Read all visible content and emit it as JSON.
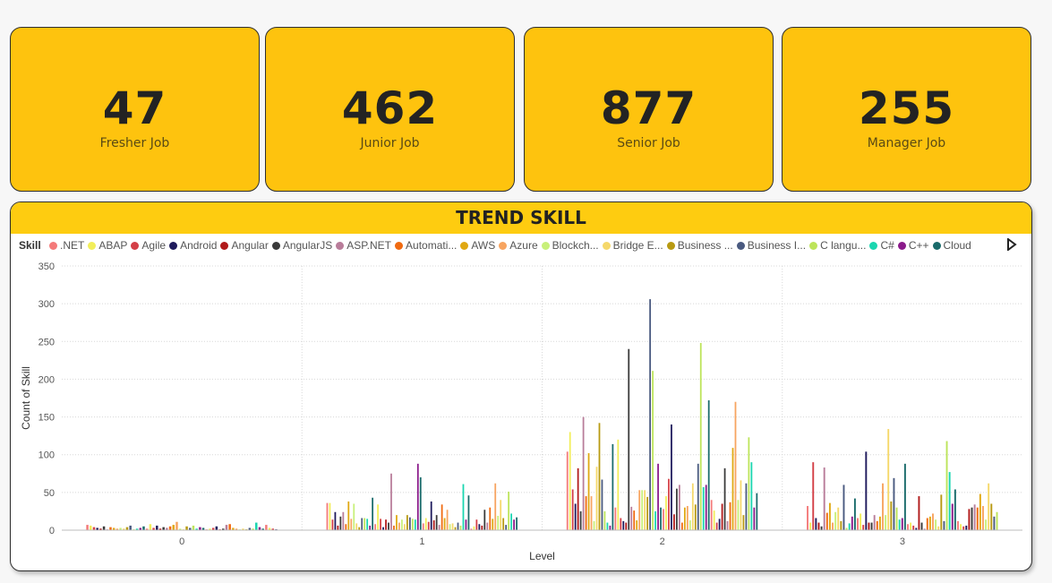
{
  "kpis": [
    {
      "value": "47",
      "label": "Fresher Job"
    },
    {
      "value": "462",
      "label": "Junior Job"
    },
    {
      "value": "877",
      "label": "Senior Job"
    },
    {
      "value": "255",
      "label": "Manager Job"
    }
  ],
  "colors": {
    "card": "#fec30e",
    "header": "#fecc10"
  },
  "legend_nav_icon": "triangle-right-icon",
  "chart_data": {
    "type": "bar",
    "title": "TREND SKILL",
    "xlabel": "Level",
    "ylabel": "Count of Skill",
    "legend_title": "Skill",
    "legend_placement": "top-left",
    "grid": true,
    "ylim": [
      0,
      350
    ],
    "yticks": [
      "0",
      "50",
      "100",
      "150",
      "200",
      "250",
      "300",
      "350"
    ],
    "categories": [
      "0",
      "1",
      "2",
      "3"
    ],
    "legend": [
      {
        "name": ".NET",
        "color": "#f47a7a"
      },
      {
        "name": "ABAP",
        "color": "#f2ee5a"
      },
      {
        "name": "Agile",
        "color": "#d43f47"
      },
      {
        "name": "Android",
        "color": "#1e1a5c"
      },
      {
        "name": "Angular",
        "color": "#b11a1a"
      },
      {
        "name": "AngularJS",
        "color": "#3a3a3a"
      },
      {
        "name": "ASP.NET",
        "color": "#b97d9a"
      },
      {
        "name": "Automati...",
        "color": "#f06a10"
      },
      {
        "name": "AWS",
        "color": "#e0a812"
      },
      {
        "name": "Azure",
        "color": "#f7a460"
      },
      {
        "name": "Blockch...",
        "color": "#c8f07a"
      },
      {
        "name": "Bridge E...",
        "color": "#f5d86a"
      },
      {
        "name": "Business ...",
        "color": "#b89a12"
      },
      {
        "name": "Business I...",
        "color": "#4a5a80"
      },
      {
        "name": "C langu...",
        "color": "#bde45a"
      },
      {
        "name": "C#",
        "color": "#1ad6b0"
      },
      {
        "name": "C++",
        "color": "#8a1a8a"
      },
      {
        "name": "Cloud",
        "color": "#1a6b6b"
      }
    ],
    "series_values": [
      [
        7,
        6,
        4,
        3,
        2,
        5,
        1,
        4,
        3,
        2,
        3,
        2,
        4,
        6,
        1,
        2,
        3,
        5,
        2,
        8,
        3,
        6,
        2,
        4,
        3,
        5,
        7,
        11,
        2,
        1,
        5,
        3,
        6,
        2,
        4,
        3,
        1,
        2,
        3,
        5,
        1,
        2,
        7,
        8,
        3,
        2,
        1,
        2,
        1,
        3,
        2,
        10,
        4,
        2,
        7,
        3,
        2,
        1
      ],
      [
        36,
        36,
        14,
        24,
        6,
        18,
        24,
        8,
        38,
        15,
        35,
        9,
        4,
        16,
        16,
        15,
        6,
        43,
        8,
        34,
        15,
        4,
        14,
        10,
        75,
        6,
        20,
        10,
        14,
        8,
        20,
        17,
        15,
        14,
        88,
        70,
        9,
        16,
        11,
        38,
        13,
        20,
        7,
        34,
        16,
        27,
        8,
        9,
        4,
        10,
        6,
        61,
        14,
        46,
        2,
        5,
        14,
        8,
        6,
        27,
        10,
        30,
        15,
        62,
        19,
        40,
        16,
        7,
        51,
        22,
        14,
        17
      ],
      [
        104,
        130,
        54,
        35,
        82,
        25,
        150,
        45,
        102,
        45,
        12,
        84,
        142,
        67,
        25,
        10,
        6,
        114,
        30,
        120,
        16,
        12,
        10,
        240,
        31,
        26,
        13,
        53,
        53,
        53,
        44,
        306,
        211,
        25,
        88,
        30,
        28,
        45,
        68,
        140,
        21,
        55,
        60,
        10,
        30,
        32,
        13,
        62,
        34,
        88,
        248,
        57,
        60,
        172,
        40,
        26,
        10,
        15,
        35,
        82,
        12,
        37,
        109,
        170,
        40,
        66,
        20,
        62,
        123,
        90,
        30,
        49
      ],
      [
        32,
        10,
        90,
        16,
        10,
        5,
        83,
        23,
        36,
        10,
        24,
        30,
        12,
        60,
        3,
        9,
        18,
        42,
        16,
        22,
        7,
        104,
        10,
        10,
        20,
        12,
        18,
        62,
        20,
        134,
        38,
        69,
        30,
        14,
        16,
        88,
        8,
        10,
        6,
        3,
        45,
        10,
        2,
        16,
        18,
        22,
        14,
        5,
        47,
        12,
        118,
        77,
        35,
        54,
        12,
        8,
        5,
        6,
        28,
        30,
        34,
        30,
        48,
        32,
        14,
        62,
        35,
        18,
        24
      ]
    ]
  }
}
